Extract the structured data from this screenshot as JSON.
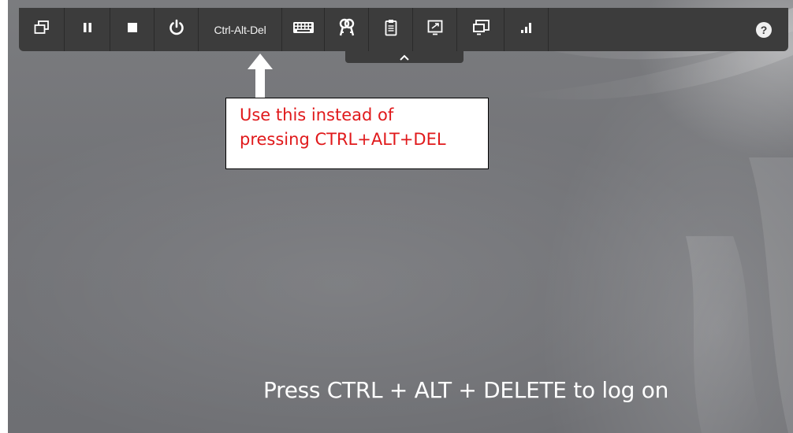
{
  "toolbar": {
    "ctrl_alt_del_label": "Ctrl-Alt-Del",
    "help_label": "?",
    "buttons": [
      {
        "icon": "restore-windows-icon"
      },
      {
        "icon": "pause-icon"
      },
      {
        "icon": "stop-icon"
      },
      {
        "icon": "power-icon"
      },
      {
        "icon": "ctrl-alt-del-button"
      },
      {
        "icon": "keyboard-icon"
      },
      {
        "icon": "keys-icon"
      },
      {
        "icon": "clipboard-icon"
      },
      {
        "icon": "fit-to-screen-icon"
      },
      {
        "icon": "multi-monitor-icon"
      },
      {
        "icon": "signal-strength-icon"
      },
      {
        "icon": "help-icon"
      }
    ]
  },
  "callout": {
    "line1": "Use this instead of",
    "line2": "pressing CTRL+ALT+DEL"
  },
  "logon_prompt": "Press CTRL + ALT + DELETE to log on",
  "colors": {
    "toolbar_bg": "#3c3c3c",
    "callout_text": "#e0191b",
    "background": "#727377"
  }
}
